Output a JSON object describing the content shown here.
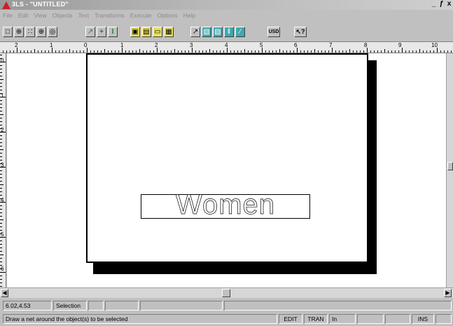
{
  "window": {
    "title": "3LS - \"UNTITLED\"",
    "controls": [
      "_",
      "ƒ",
      "x"
    ]
  },
  "menu": [
    "File",
    "Edit",
    "View",
    "Objects",
    "Text",
    "Transforms",
    "Execute",
    "Options",
    "Help"
  ],
  "toolbar": {
    "buttons": [
      {
        "icon": "square-icon",
        "glyph": "□"
      },
      {
        "icon": "zoom-icon",
        "glyph": "⊕"
      },
      {
        "icon": "grid-icon",
        "glyph": "∷"
      },
      {
        "icon": "crosshair-icon",
        "glyph": "⊕"
      },
      {
        "icon": "circle-icon",
        "glyph": "◎"
      },
      {
        "icon": "pen-icon",
        "glyph": "↗"
      },
      {
        "icon": "plus-icon",
        "glyph": "+"
      },
      {
        "icon": "text-cursor-icon",
        "glyph": "I"
      },
      {
        "icon": "yellow-tool-1-icon",
        "glyph": "▣"
      },
      {
        "icon": "yellow-tool-2-icon",
        "glyph": "▤"
      },
      {
        "icon": "yellow-tool-3-icon",
        "glyph": "▭"
      },
      {
        "icon": "yellow-tool-4-icon",
        "glyph": "▦"
      },
      {
        "icon": "arrow-tool-icon",
        "glyph": "↗"
      },
      {
        "icon": "teal-tool-1-icon",
        "glyph": "▧"
      },
      {
        "icon": "teal-tool-2-icon",
        "glyph": "▨"
      },
      {
        "icon": "teal-tool-3-icon",
        "glyph": "‖"
      },
      {
        "icon": "teal-tool-4-icon",
        "glyph": "∕"
      },
      {
        "icon": "usd-icon",
        "glyph": "USD"
      },
      {
        "icon": "help-pointer-icon",
        "glyph": "↖?"
      }
    ]
  },
  "ruler": {
    "h_labels": [
      "2",
      "1",
      "0",
      "1",
      "2",
      "3",
      "4",
      "5",
      "6",
      "7",
      "8",
      "9",
      "10"
    ],
    "v_labels": [
      "0",
      "1",
      "2",
      "3",
      "4",
      "5",
      "6"
    ]
  },
  "document": {
    "text_object": "Women"
  },
  "status": {
    "coords": "6.02,4.53",
    "mode": "Selection",
    "hint": "Draw a net around the object(s) to be selected",
    "edit": "EDIT",
    "tran": "TRAN",
    "units": "In",
    "ins": "INS"
  }
}
